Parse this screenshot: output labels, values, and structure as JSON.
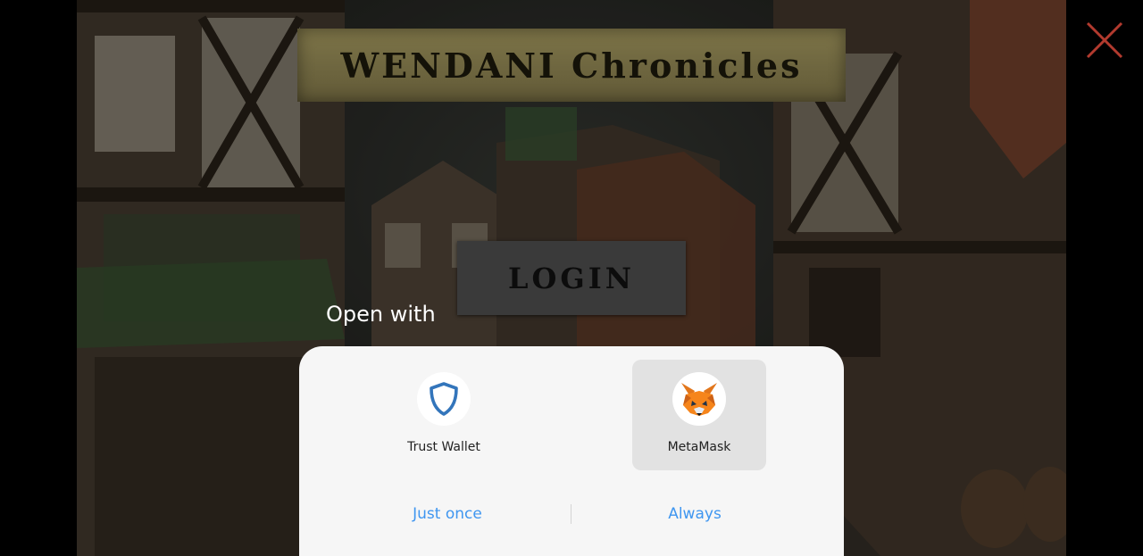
{
  "game": {
    "title": "WENDANI Chronicles",
    "login_label": "LOGIN"
  },
  "dialog": {
    "header": "Open with",
    "apps": [
      {
        "label": "Trust Wallet",
        "icon": "trust-wallet-shield-icon",
        "selected": false
      },
      {
        "label": "MetaMask",
        "icon": "metamask-fox-icon",
        "selected": true
      }
    ],
    "actions": {
      "just_once": "Just once",
      "always": "Always"
    }
  },
  "colors": {
    "accent_blue": "#3f96f0",
    "trust_blue": "#3375bb",
    "banner": "#766d44",
    "sheet_bg": "#f6f6f6",
    "selected_bg": "#e2e2e2",
    "close_red": "#b23a2e"
  }
}
